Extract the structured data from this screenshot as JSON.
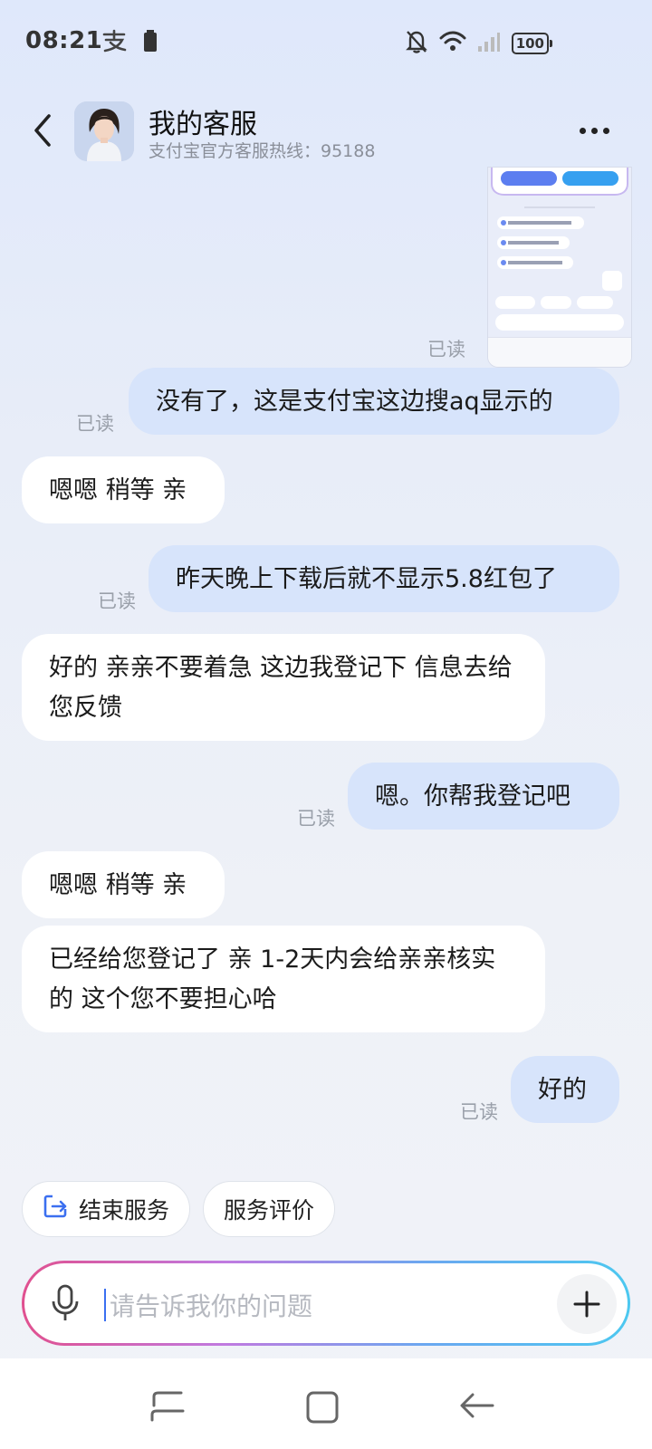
{
  "status_bar": {
    "time": "08:21",
    "battery": "100",
    "icons": [
      "alipay-icon",
      "battery-icon",
      "bell-off-icon",
      "wifi-icon",
      "signal-icon"
    ]
  },
  "header": {
    "title": "我的客服",
    "subtitle": "支付宝官方客服热线：95188",
    "icons": [
      "back-icon",
      "avatar",
      "more-icon"
    ]
  },
  "messages": [
    {
      "side": "me",
      "type": "image",
      "status": "已读"
    },
    {
      "side": "me",
      "text": "没有了，这是支付宝这边搜aq显示的",
      "status": "已读"
    },
    {
      "side": "them",
      "text": "嗯嗯 稍等 亲"
    },
    {
      "side": "me",
      "text": "昨天晚上下载后就不显示5.8红包了",
      "status": "已读"
    },
    {
      "side": "them",
      "text": "好的 亲亲不要着急 这边我登记下 信息去给您反馈"
    },
    {
      "side": "me",
      "text": "嗯。你帮我登记吧",
      "status": "已读"
    },
    {
      "side": "them",
      "text": "嗯嗯 稍等 亲"
    },
    {
      "side": "them",
      "text": "已经给您登记了 亲 1-2天内会给亲亲核实 的 这个您不要担心哈"
    },
    {
      "side": "me",
      "text": "好的",
      "status": "已读"
    }
  ],
  "quick_actions": [
    {
      "label": "结束服务",
      "icon": "exit-icon"
    },
    {
      "label": "服务评价"
    }
  ],
  "input": {
    "placeholder": "请告诉我你的问题",
    "icons": [
      "mic-icon",
      "plus-icon"
    ]
  },
  "nav_bar": {
    "icons": [
      "recent-apps-icon",
      "home-icon",
      "back-nav-icon"
    ]
  }
}
